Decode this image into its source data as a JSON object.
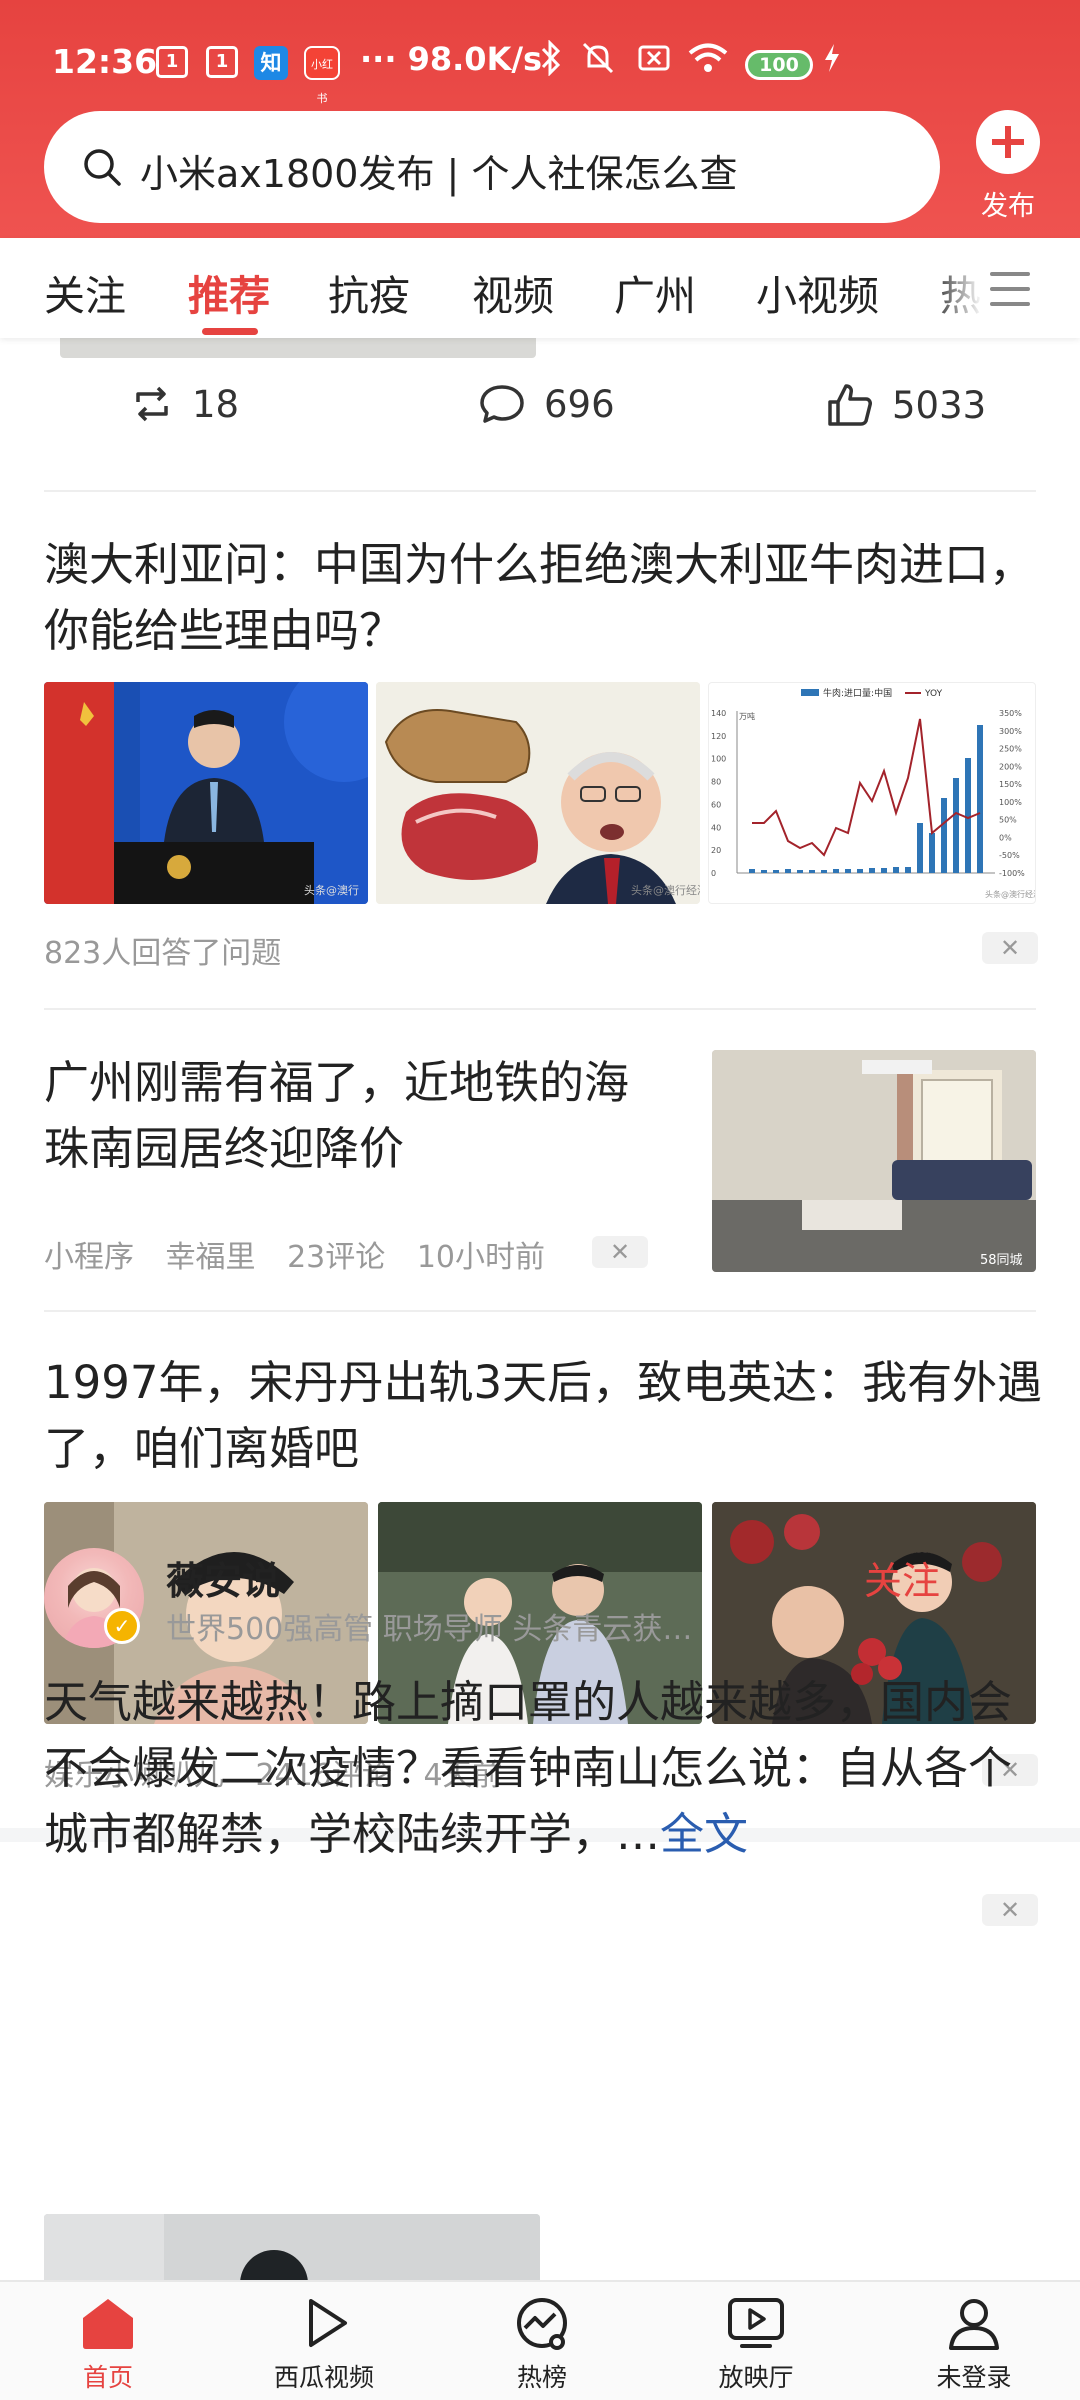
{
  "status_bar": {
    "time": "12:36",
    "mini_1": "1",
    "mini_2": "1",
    "zhihu": "知",
    "app_badge": "小红书",
    "dots": "···",
    "net_speed": "98.0K/s",
    "battery": "100"
  },
  "search": {
    "placeholder_text": "小米ax1800发布 | 个人社保怎么查"
  },
  "publish": {
    "label": "发布"
  },
  "tabs": [
    {
      "label": "关注"
    },
    {
      "label": "推荐",
      "active": true
    },
    {
      "label": "抗疫"
    },
    {
      "label": "视频"
    },
    {
      "label": "广州"
    },
    {
      "label": "小视频"
    },
    {
      "label": "热"
    }
  ],
  "prev_post_actions": {
    "repost_count": "18",
    "comment_count": "696",
    "like_count": "5033"
  },
  "articles": [
    {
      "title": "澳大利亚问：中国为什么拒绝澳大利亚牛肉进口，你能给些理由吗？",
      "meta": [
        "823人回答了问题"
      ],
      "image_watermarks": [
        "头条@澳行",
        "头条@澳行经济",
        "头条@澳行经济"
      ]
    },
    {
      "title": "广州刚需有福了，近地铁的海珠南园居终迎降价",
      "meta": [
        "小程序",
        "幸福里",
        "23评论",
        "10小时前"
      ],
      "image_watermark": "58同城"
    },
    {
      "title": "1997年，宋丹丹出轨3天后，致电英达：我有外遇了，咱们离婚吧",
      "meta": [
        "娱乐小喇叭儿",
        "2416评论",
        "4天前"
      ]
    }
  ],
  "author_post": {
    "author": "薇安说",
    "description": "世界500强高管 职场导师 头条青云获…",
    "follow_label": "关注",
    "text": "天气越来越热！路上摘口罩的人越来越多，国内会不会爆发二次疫情？看看钟南山怎么说：自从各个城市都解禁，学校陆续开学，…",
    "more_label": "全文"
  },
  "chart_thumb": {
    "legend_bar": "牛肉:进口量:中国",
    "legend_line": "YOY",
    "unit": "万吨",
    "y_left_ticks": [
      "140",
      "120",
      "100",
      "80",
      "60",
      "40",
      "20",
      "0"
    ],
    "y_right_ticks": [
      "350%",
      "300%",
      "250%",
      "200%",
      "150%",
      "100%",
      "50%",
      "0%",
      "-50%",
      "-100%"
    ]
  },
  "bottom_nav": [
    {
      "label": "首页",
      "active": true
    },
    {
      "label": "西瓜视频"
    },
    {
      "label": "热榜"
    },
    {
      "label": "放映厅"
    },
    {
      "label": "未登录"
    }
  ],
  "colors": {
    "brand_red": "#e64340",
    "link_blue": "#2a5db0",
    "meta_gray": "#999999"
  }
}
